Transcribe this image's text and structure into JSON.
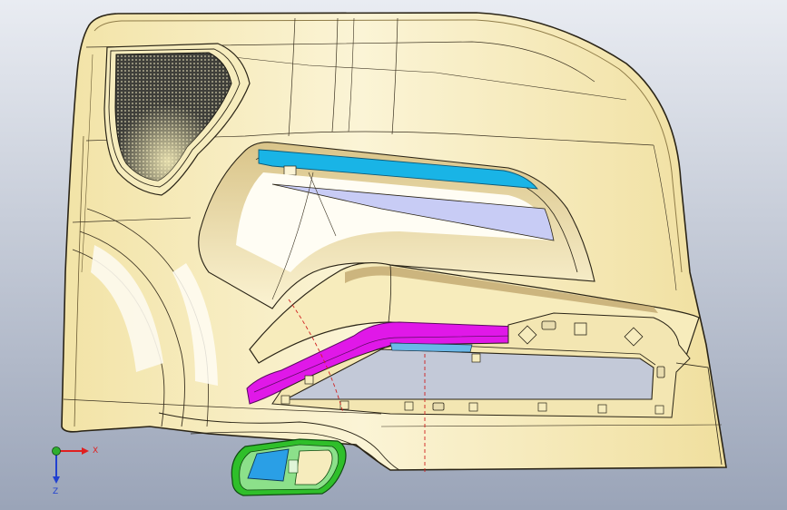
{
  "viewport": {
    "background_top": "#e9ecf2",
    "background_bottom": "#9aa4b8"
  },
  "colors": {
    "part_fill": "#f5e9b0",
    "part_light": "#fbf4d6",
    "part_shadow": "#cdb878",
    "edge": "#2a2416",
    "speaker_grille": "#4a4a44",
    "window_sill_blue": "#19b4e6",
    "inner_panel_lavender": "#c8ccf5",
    "armrest_magenta": "#e018e8",
    "switch_bezel_green": "#2fbf2a",
    "switch_blue": "#2a9fe6",
    "axis_x": "#e02020",
    "axis_y": "#2fae2f",
    "axis_z": "#2040d0"
  },
  "triad": {
    "x_label": "X",
    "z_label": "Z"
  },
  "icons": {
    "triad": "coordinate-triad-icon"
  }
}
